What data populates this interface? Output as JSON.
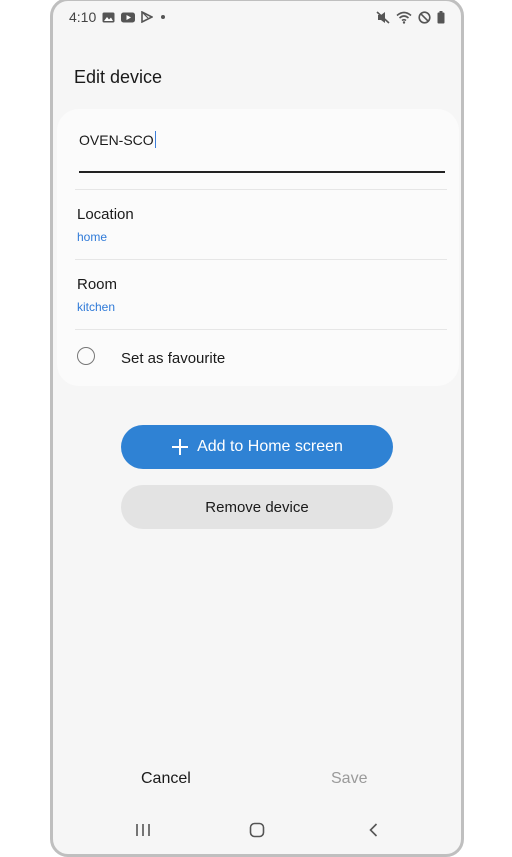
{
  "status_bar": {
    "time": "4:10",
    "left_icons": [
      "gallery-icon",
      "youtube-icon",
      "play-store-icon",
      "dot-icon"
    ],
    "right_icons": [
      "mute-icon",
      "wifi-icon",
      "dnd-icon",
      "battery-icon"
    ]
  },
  "page": {
    "title": "Edit device"
  },
  "device_name": {
    "value": "OVEN-SCO"
  },
  "location": {
    "title": "Location",
    "value": "home"
  },
  "room": {
    "title": "Room",
    "value": "kitchen"
  },
  "favourite": {
    "label": "Set as favourite",
    "checked": false
  },
  "buttons": {
    "add_home": "Add to Home screen",
    "remove": "Remove device",
    "cancel": "Cancel",
    "save": "Save"
  },
  "colors": {
    "accent": "#2f82d4",
    "link": "#2f7ad8",
    "disabled": "#9a9a9a"
  },
  "nav_icons": [
    "recents-icon",
    "home-icon",
    "back-icon"
  ]
}
